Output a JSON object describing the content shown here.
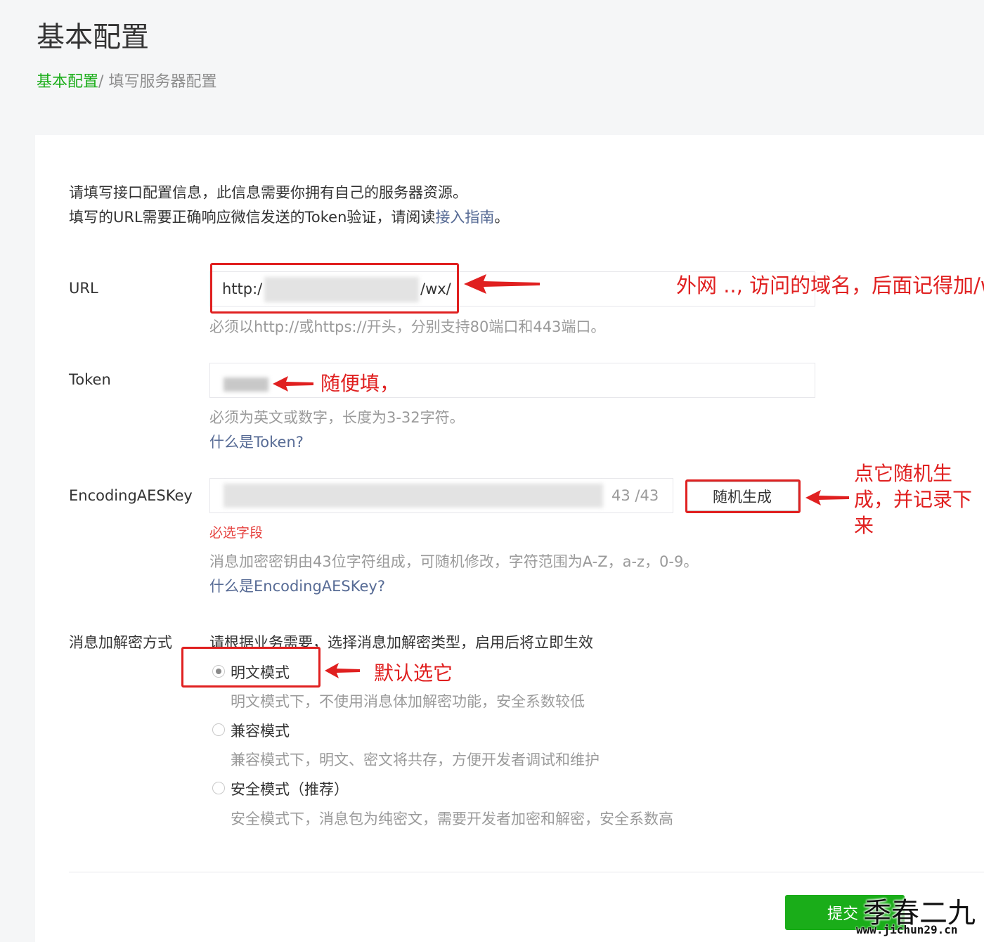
{
  "header": {
    "title": "基本配置",
    "breadcrumb": {
      "link": "基本配置",
      "separator": "/",
      "current": "填写服务器配置"
    }
  },
  "intro": {
    "line1": "请填写接口配置信息，此信息需要你拥有自己的服务器资源。",
    "line2_prefix": "填写的URL需要正确响应微信发送的Token验证，请阅读",
    "line2_link": "接入指南",
    "line2_suffix": "。"
  },
  "url_field": {
    "label": "URL",
    "value_prefix": "http:/",
    "value_suffix": "/wx/",
    "hint": "必须以http://或https://开头，分别支持80端口和443端口。",
    "annotation": "外网 ..,    访问的域名，后面记得加/wx/"
  },
  "token_field": {
    "label": "Token",
    "hint": "必须为英文或数字，长度为3-32字符。",
    "help_link": "什么是Token?",
    "annotation": "随便填，"
  },
  "aes_field": {
    "label": "EncodingAESKey",
    "counter": "43 /43",
    "generate_button": "随机生成",
    "required": "必选字段",
    "hint": "消息加密密钥由43位字符组成，可随机修改，字符范围为A-Z，a-z，0-9。",
    "help_link": "什么是EncodingAESKey?",
    "annotation_lines": [
      "点它随机生",
      "成，并记录下",
      "来"
    ]
  },
  "encrypt_mode": {
    "label": "消息加解密方式",
    "description": "请根据业务需要，选择消息加解密类型，启用后将立即生效",
    "options": [
      {
        "label": "明文模式",
        "desc": "明文模式下，不使用消息体加解密功能，安全系数较低"
      },
      {
        "label": "兼容模式",
        "desc": "兼容模式下，明文、密文将共存，方便开发者调试和维护"
      },
      {
        "label": "安全模式（推荐）",
        "desc": "安全模式下，消息包为纯密文，需要开发者加密和解密，安全系数高"
      }
    ],
    "annotation": "默认选它"
  },
  "footer": {
    "submit": "提交"
  },
  "watermark": {
    "name": "季春二九",
    "url": "www.jichun29.cn"
  }
}
